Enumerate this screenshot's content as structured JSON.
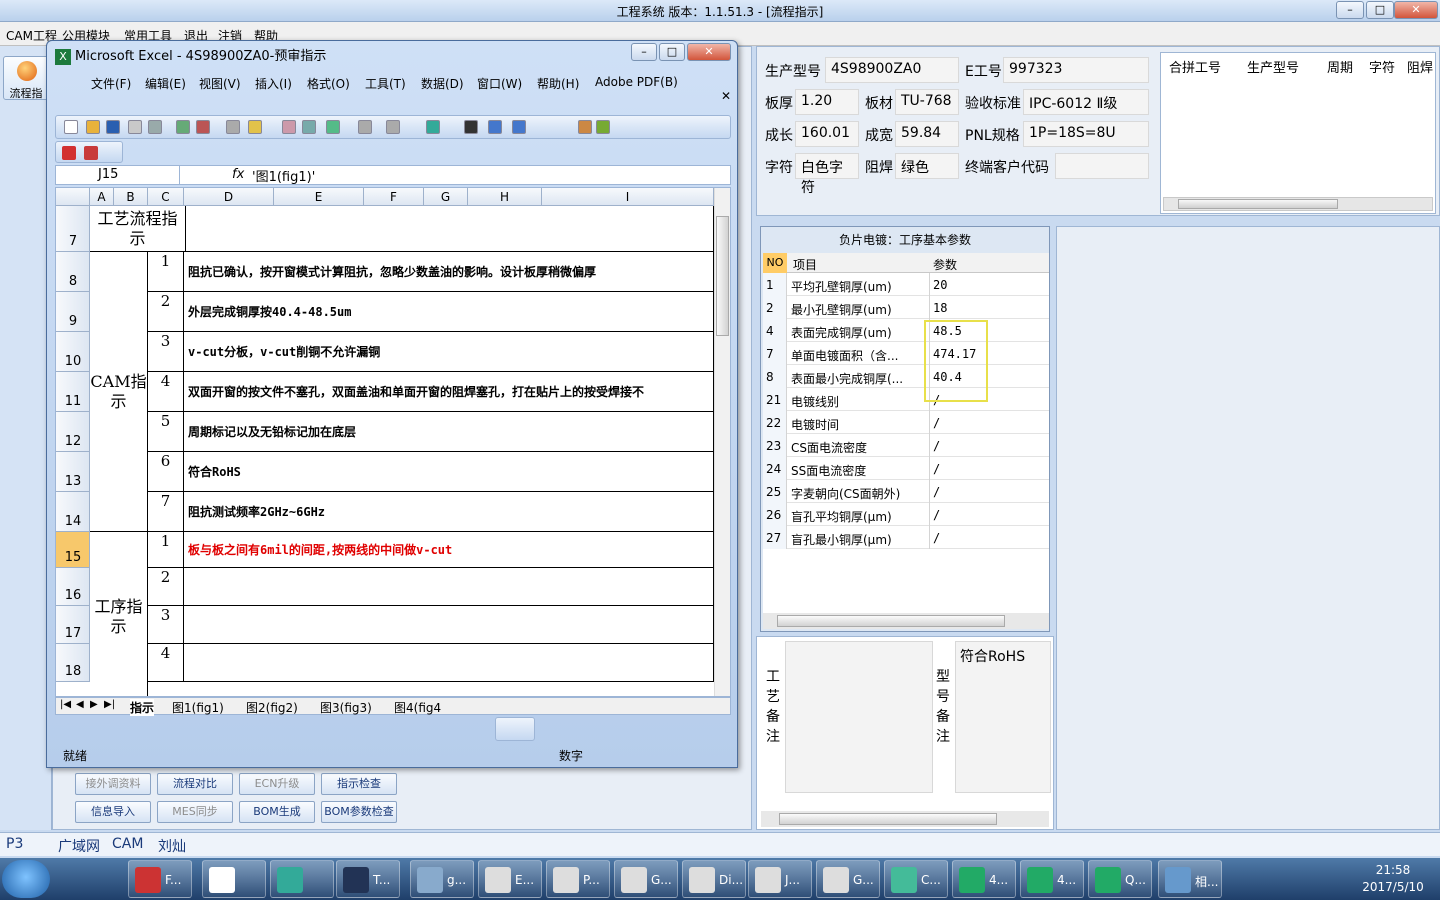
{
  "app": {
    "title": "工程系统  版本：1.1.51.3 - [流程指示]",
    "menu": [
      "CAM工程",
      "公用模块",
      "常用工具",
      "退出",
      "注销",
      "帮助"
    ],
    "flow_button": "流程指"
  },
  "excel": {
    "title": "Microsoft Excel - 4S98900ZA0-预审指示",
    "menu": [
      "文件(F)",
      "编辑(E)",
      "视图(V)",
      "插入(I)",
      "格式(O)",
      "工具(T)",
      "数据(D)",
      "窗口(W)",
      "帮助(H)",
      "Adobe PDF(B)"
    ],
    "namebox": "J15",
    "fx": "fx",
    "formula": "'图1(fig1)'",
    "columns": [
      "A",
      "B",
      "C",
      "D",
      "E",
      "F",
      "G",
      "H",
      "I"
    ],
    "rows": [
      "7",
      "8",
      "9",
      "10",
      "11",
      "12",
      "13",
      "14",
      "15",
      "16",
      "17",
      "18"
    ],
    "group1": "工艺流程指示",
    "group2": "CAM指示",
    "group3": "工序指示",
    "items": [
      {
        "n": "1",
        "t": "阻抗已确认，按开窗模式计算阻抗，忽略少数盖油的影响。设计板厚稍微偏厚"
      },
      {
        "n": "2",
        "t": "外层完成铜厚按40.4-48.5um"
      },
      {
        "n": "3",
        "t": "v-cut分板，v-cut削铜不允许漏铜"
      },
      {
        "n": "4",
        "t": "双面开窗的按文件不塞孔，双面盖油和单面开窗的阻焊塞孔，打在贴片上的按受焊接不"
      },
      {
        "n": "5",
        "t": "周期标记以及无铅标记加在底层"
      },
      {
        "n": "6",
        "t": "符合RoHS"
      },
      {
        "n": "7",
        "t": "阻抗测试频率2GHz~6GHz"
      }
    ],
    "items2": [
      {
        "n": "1",
        "t": "板与板之间有6mil的间距,按两线的中间做v-cut"
      },
      {
        "n": "2",
        "t": ""
      },
      {
        "n": "3",
        "t": ""
      },
      {
        "n": "4",
        "t": ""
      }
    ],
    "sheet_tabs": [
      "指示",
      "图1(fig1)",
      "图2(fig2)",
      "图3(fig3)",
      "图4(fig4"
    ],
    "status": "就绪",
    "status_num": "数字"
  },
  "func_buttons": [
    [
      "接外调资料",
      "流程对比",
      "ECN升级",
      "指示检查"
    ],
    [
      "信息导入",
      "MES同步",
      "BOM生成",
      "BOM参数检查"
    ]
  ],
  "info": {
    "model_label": "生产型号",
    "model": "4S98900ZA0",
    "e_label": "E工号",
    "e_value": "997323",
    "thick_label": "板厚",
    "thick": "1.20",
    "mat_label": "板材",
    "mat": "TU-768",
    "std_label": "验收标准",
    "std": "IPC-6012 Ⅱ级",
    "len_label": "成长",
    "len": "160.01",
    "wid_label": "成宽",
    "wid": "59.84",
    "pnl_label": "PNL规格",
    "pnl": "1P=18S=8U",
    "char_label": "字符",
    "char": "白色字符",
    "mask_label": "阻焊",
    "mask": "绿色",
    "cust_label": "终端客户代码",
    "cust": ""
  },
  "merge_list": {
    "headers": [
      "合拼工号",
      "生产型号",
      "周期",
      "字符",
      "阻焊"
    ]
  },
  "params": {
    "title": "负片电镀：工序基本参数",
    "headers": [
      "NO",
      "项目",
      "参数"
    ],
    "rows": [
      [
        "1",
        "平均孔壁铜厚(um)",
        "20"
      ],
      [
        "2",
        "最小孔壁铜厚(um)",
        "18"
      ],
      [
        "4",
        "表面完成铜厚(um)",
        "48.5"
      ],
      [
        "7",
        "单面电镀面积（含...",
        "474.17"
      ],
      [
        "8",
        "表面最小完成铜厚(...",
        "40.4"
      ],
      [
        "21",
        "电镀线别",
        "/"
      ],
      [
        "22",
        "电镀时间",
        "/"
      ],
      [
        "23",
        "CS面电流密度",
        "/"
      ],
      [
        "24",
        "SS面电流密度",
        "/"
      ],
      [
        "25",
        "字麦朝向(CS面朝外)",
        "/"
      ],
      [
        "26",
        "盲孔平均铜厚(μm)",
        "/"
      ],
      [
        "27",
        "盲孔最小铜厚(μm)",
        "/"
      ]
    ]
  },
  "memo": {
    "label1": "工艺备注",
    "label2": "型号备注",
    "text2": "符合RoHS"
  },
  "bottom": {
    "p": "P3",
    "links": [
      "广域网",
      "CAM",
      "刘灿"
    ]
  },
  "taskbar": {
    "items": [
      "F...",
      "",
      "",
      "T...",
      "g...",
      "E...",
      "P...",
      "G...",
      "Di...",
      "J...",
      "G...",
      "C...",
      "4...",
      "4...",
      "Q...",
      "相..."
    ],
    "time": "21:58",
    "date": "2017/5/10"
  }
}
